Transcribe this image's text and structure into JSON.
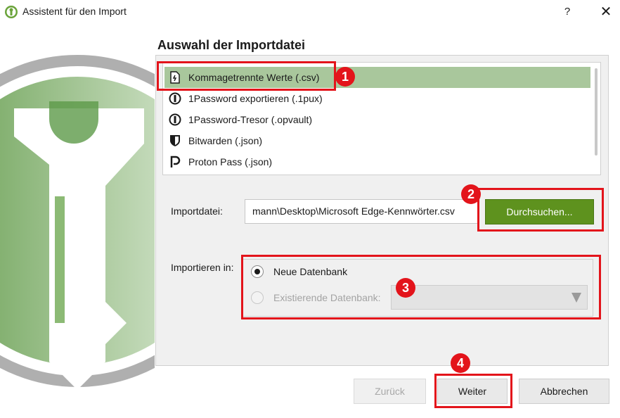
{
  "window": {
    "title": "Assistent für den Import",
    "help_label": "?",
    "close_label": "✕"
  },
  "page": {
    "heading": "Auswahl der Importdatei"
  },
  "formats": {
    "items": [
      {
        "label": "Kommagetrennte Werte (.csv)",
        "icon": "csv-file-icon",
        "selected": true
      },
      {
        "label": "1Password exportieren (.1pux)",
        "icon": "1password-icon",
        "selected": false
      },
      {
        "label": "1Password-Tresor (.opvault)",
        "icon": "1password-icon",
        "selected": false
      },
      {
        "label": "Bitwarden (.json)",
        "icon": "bitwarden-shield-icon",
        "selected": false
      },
      {
        "label": "Proton Pass (.json)",
        "icon": "proton-pass-icon",
        "selected": false
      }
    ]
  },
  "import_file": {
    "label": "Importdatei:",
    "value": "mann\\Desktop\\Microsoft Edge-Kennwörter.csv",
    "browse_label": "Durchsuchen..."
  },
  "import_into": {
    "label": "Importieren in:",
    "new_db_label": "Neue Datenbank",
    "existing_db_label": "Existierende Datenbank:",
    "selected": "new"
  },
  "footer": {
    "back_label": "Zurück",
    "next_label": "Weiter",
    "cancel_label": "Abbrechen"
  },
  "annotations": {
    "badge1": "1",
    "badge2": "2",
    "badge3": "3",
    "badge4": "4"
  },
  "colors": {
    "accent_green": "#5e921e",
    "selection_green": "#a9c79c",
    "highlight_red": "#e3141b"
  }
}
